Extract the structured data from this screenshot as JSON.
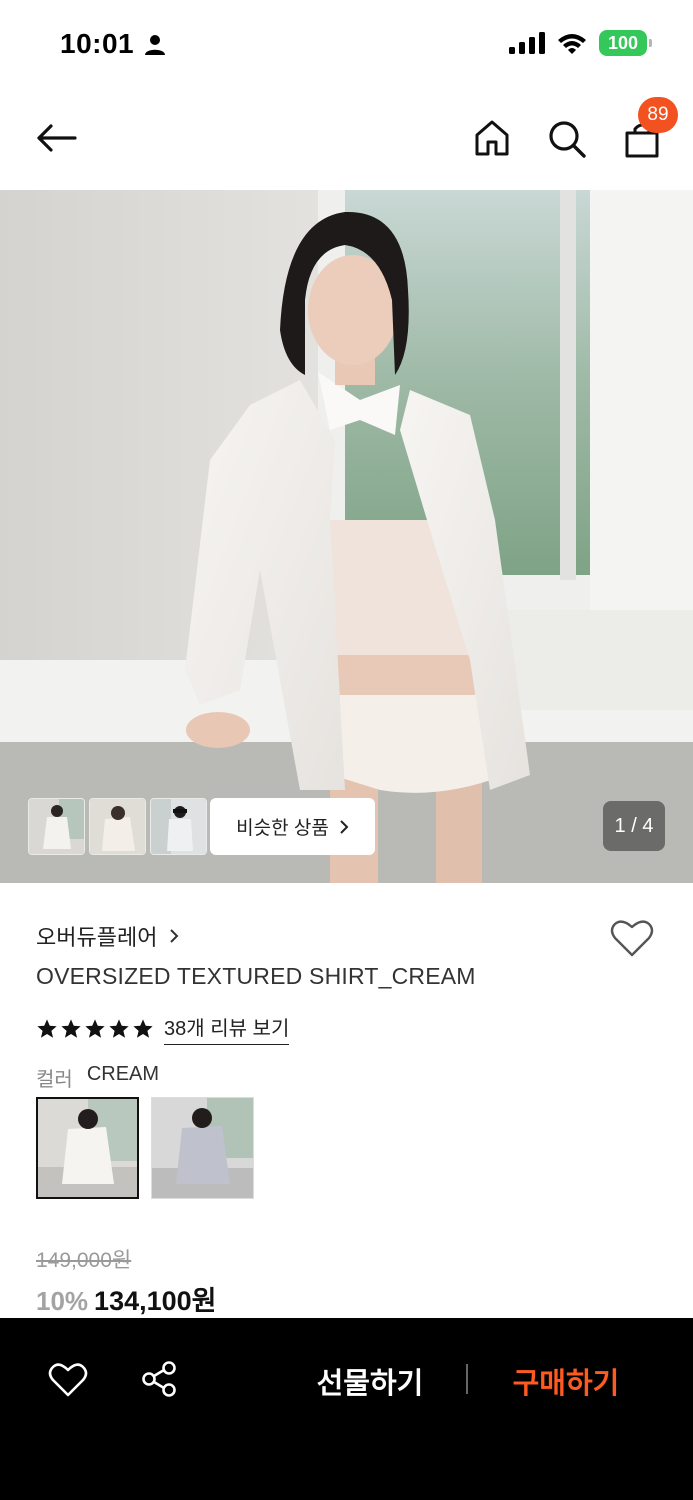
{
  "status_bar": {
    "time": "10:01",
    "battery": "100"
  },
  "header": {
    "cart_count": "89"
  },
  "gallery": {
    "similar_label": "비슷한 상품",
    "counter": "1 / 4"
  },
  "product": {
    "brand": "오버듀플레어",
    "title": "OVERSIZED TEXTURED SHIRT_CREAM",
    "rating_stars": 5,
    "review_link": "38개 리뷰 보기",
    "color_label": "컬러",
    "color_value": "CREAM",
    "original_price": "149,000원",
    "discount": "10%",
    "price": "134,100원"
  },
  "bottom_bar": {
    "gift_label": "선물하기",
    "buy_label": "구매하기"
  },
  "colors": {
    "accent": "#f2521f",
    "buy": "#ff5a1f",
    "battery": "#34c759"
  }
}
